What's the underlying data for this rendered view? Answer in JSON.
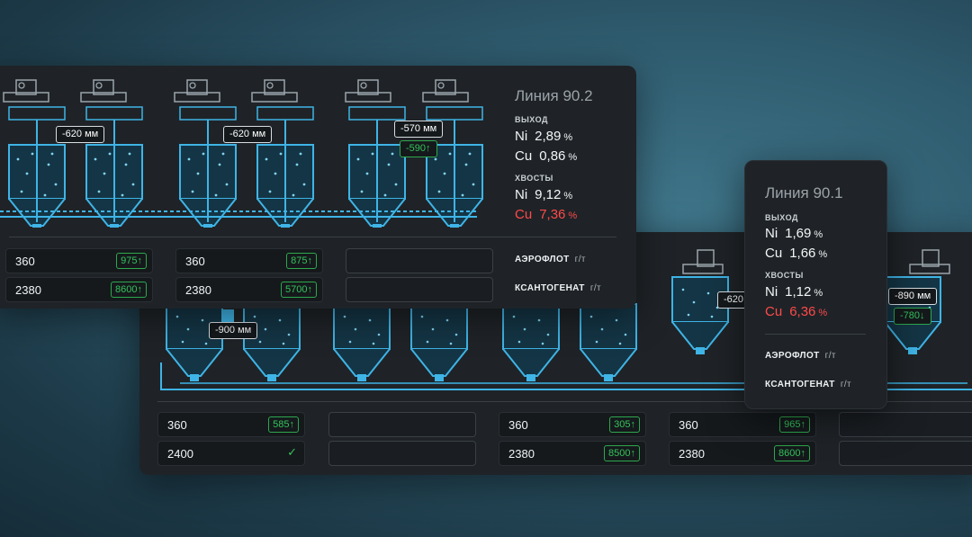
{
  "line_back": {
    "tags": {
      "level_a": "-900 мм",
      "level_b": "-620",
      "level_c": "-890 мм",
      "setpoint_c": "-780↓"
    },
    "rows": [
      {
        "a": "360",
        "a_badge": "585↑",
        "b": "",
        "c": "360",
        "c_badge": "305↑",
        "d": "360",
        "d_badge": "965↑"
      },
      {
        "a": "2400",
        "a_badge": "✓",
        "b": "",
        "c": "2380",
        "c_badge": "8500↑",
        "d": "2380",
        "d_badge": "8600↑"
      }
    ]
  },
  "line_front": {
    "tags": {
      "level_1": "-620 мм",
      "level_2": "-620 мм",
      "level_3": "-570 мм",
      "setpoint_3": "-590↑"
    },
    "title": "Линия 90.2",
    "output_label": "ВЫХОД",
    "output": [
      {
        "el": "Ni",
        "val": "2,89",
        "unit": "%"
      },
      {
        "el": "Cu",
        "val": "0,86",
        "unit": "%"
      }
    ],
    "tails_label": "ХВОСТЫ",
    "tails": [
      {
        "el": "Ni",
        "val": "9,12",
        "unit": "%"
      },
      {
        "el": "Cu",
        "val": "7,36",
        "unit": "%"
      }
    ],
    "reagents": [
      {
        "name": "АЭРОФЛОТ",
        "unit": "г/т"
      },
      {
        "name": "КСАНТОГЕНАТ",
        "unit": "г/т"
      }
    ],
    "rows": [
      {
        "a": "360",
        "a_badge": "975↑",
        "b": "360",
        "b_badge": "875↑"
      },
      {
        "a": "2380",
        "a_badge": "8600↑",
        "b": "2380",
        "b_badge": "5700↑"
      }
    ]
  },
  "card_901": {
    "title": "Линия 90.1",
    "output_label": "ВЫХОД",
    "output": [
      {
        "el": "Ni",
        "val": "1,69",
        "unit": "%"
      },
      {
        "el": "Cu",
        "val": "1,66",
        "unit": "%"
      }
    ],
    "tails_label": "ХВОСТЫ",
    "tails": [
      {
        "el": "Ni",
        "val": "1,12",
        "unit": "%"
      },
      {
        "el": "Cu",
        "val": "6,36",
        "unit": "%"
      }
    ],
    "reagents": [
      {
        "name": "АЭРОФЛОТ",
        "unit": "г/т"
      },
      {
        "name": "КСАНТОГЕНАТ",
        "unit": "г/т"
      }
    ]
  },
  "colors": {
    "accent_blue": "#3fb4e6",
    "good": "#35c25a",
    "bad": "#ff4a4a"
  }
}
